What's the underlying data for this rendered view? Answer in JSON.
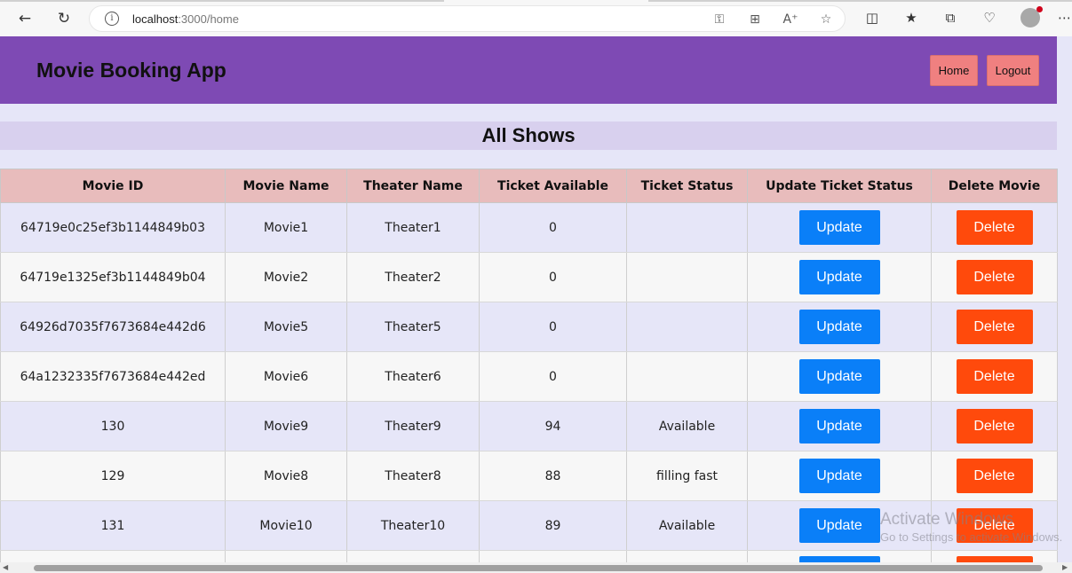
{
  "browser": {
    "url_host": "localhost",
    "url_path": ":3000/home"
  },
  "app": {
    "title": "Movie Booking App",
    "nav": {
      "home_label": "Home",
      "logout_label": "Logout"
    },
    "accent_color": "#7e4ab4"
  },
  "section": {
    "title": "All Shows"
  },
  "table": {
    "columns": [
      "Movie ID",
      "Movie Name",
      "Theater Name",
      "Ticket Available",
      "Ticket Status",
      "Update Ticket Status",
      "Delete Movie"
    ],
    "rows": [
      {
        "id": "64719e0c25ef3b1144849b03",
        "movie": "Movie1",
        "theater": "Theater1",
        "available": "0",
        "status": "",
        "update": "Update",
        "delete": "Delete"
      },
      {
        "id": "64719e1325ef3b1144849b04",
        "movie": "Movie2",
        "theater": "Theater2",
        "available": "0",
        "status": "",
        "update": "Update",
        "delete": "Delete"
      },
      {
        "id": "64926d7035f7673684e442d6",
        "movie": "Movie5",
        "theater": "Theater5",
        "available": "0",
        "status": "",
        "update": "Update",
        "delete": "Delete"
      },
      {
        "id": "64a1232335f7673684e442ed",
        "movie": "Movie6",
        "theater": "Theater6",
        "available": "0",
        "status": "",
        "update": "Update",
        "delete": "Delete"
      },
      {
        "id": "130",
        "movie": "Movie9",
        "theater": "Theater9",
        "available": "94",
        "status": "Available",
        "update": "Update",
        "delete": "Delete"
      },
      {
        "id": "129",
        "movie": "Movie8",
        "theater": "Theater8",
        "available": "88",
        "status": "filling fast",
        "update": "Update",
        "delete": "Delete"
      },
      {
        "id": "131",
        "movie": "Movie10",
        "theater": "Theater10",
        "available": "89",
        "status": "Available",
        "update": "Update",
        "delete": "Delete"
      },
      {
        "id": "",
        "movie": "",
        "theater": "",
        "available": "",
        "status": "",
        "update": "",
        "delete": ""
      }
    ]
  },
  "watermark": {
    "line1": "Activate Windows",
    "line2": "Go to Settings to activate Windows."
  }
}
